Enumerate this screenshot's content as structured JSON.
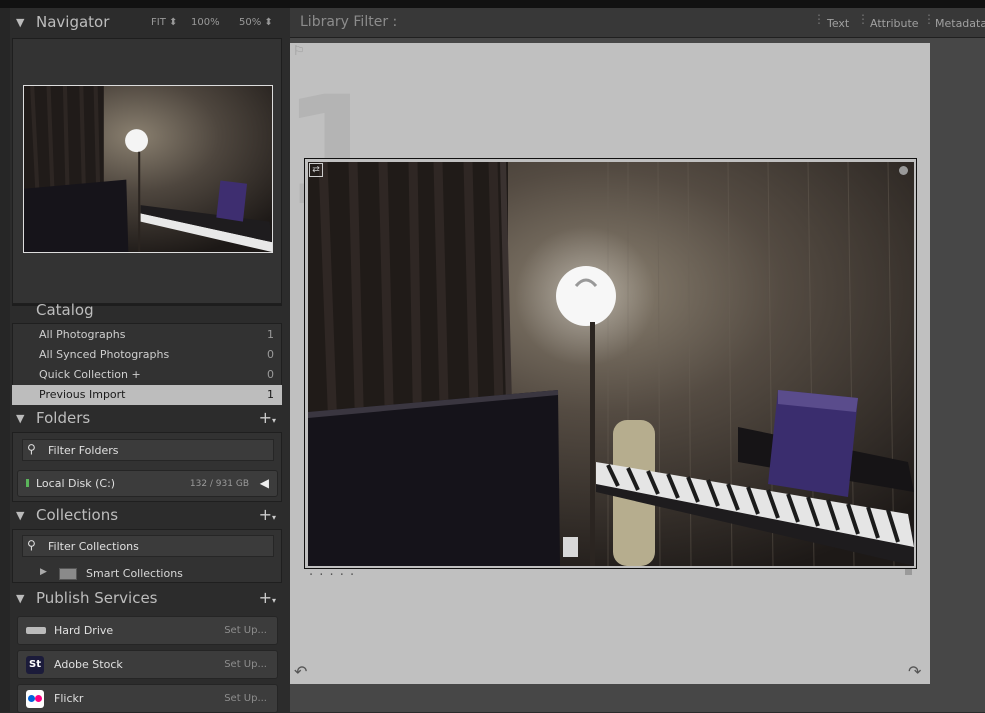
{
  "navigator": {
    "title": "Navigator",
    "zoom_fit": "FIT",
    "zoom_100": "100%",
    "zoom_50": "50%"
  },
  "catalog": {
    "title": "Catalog",
    "items": [
      {
        "label": "All Photographs",
        "count": "1"
      },
      {
        "label": "All Synced Photographs",
        "count": "0"
      },
      {
        "label": "Quick Collection  +",
        "count": "0"
      },
      {
        "label": "Previous Import",
        "count": "1"
      }
    ]
  },
  "folders": {
    "title": "Folders",
    "filter_label": "Filter Folders",
    "disk_label": "Local Disk (C:)",
    "disk_size": "132 / 931 GB"
  },
  "collections": {
    "title": "Collections",
    "filter_label": "Filter Collections",
    "smart_label": "Smart Collections"
  },
  "publish": {
    "title": "Publish Services",
    "items": [
      {
        "label": "Hard Drive",
        "action": "Set Up..."
      },
      {
        "label": "Adobe Stock",
        "action": "Set Up...",
        "badge": "St"
      },
      {
        "label": "Flickr",
        "action": "Set Up..."
      }
    ]
  },
  "filterbar": {
    "title": "Library Filter :",
    "tabs": [
      "Text",
      "Attribute",
      "Metadata"
    ]
  },
  "loupe": {
    "dots": ". . . . ."
  },
  "colors": {
    "selected_row": "#bdbdbd",
    "loupe_bg": "#c0c0c0",
    "adobe_stock": "#1b1b3a",
    "flickr_blue": "#0063dc",
    "flickr_pink": "#ff0084"
  }
}
